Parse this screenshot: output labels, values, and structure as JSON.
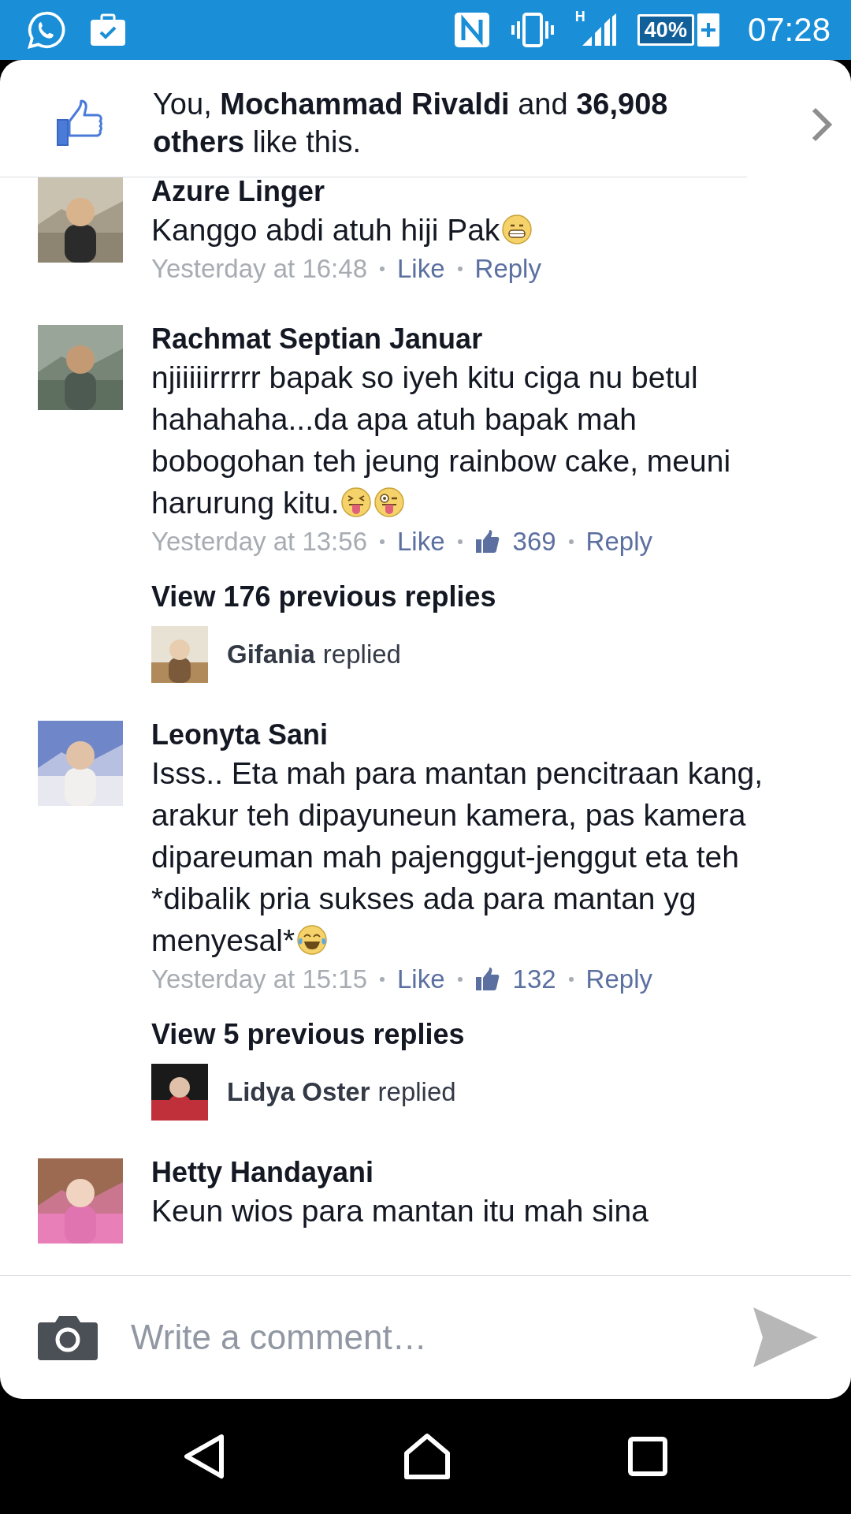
{
  "status_bar": {
    "network": "H",
    "battery": "40%",
    "time": "07:28"
  },
  "likes_summary": "You, **Mochammad Rivaldi** and **36,908 others** like this.",
  "comments": [
    {
      "author": "Azure Linger",
      "text": "Kanggo abdi atuh hiji Pak",
      "emojis": [
        {
          "kind": "grin"
        }
      ],
      "time": "Yesterday at 16:48",
      "like": "Like",
      "reply": "Reply"
    },
    {
      "author": "Rachmat Septian Januar",
      "text": "njiiiiirrrrr bapak so iyeh kitu ciga nu betul hahahaha...da apa atuh bapak mah bobogohan teh jeung rainbow cake, meuni harurung kitu.",
      "emojis": [
        {
          "kind": "tongue"
        },
        {
          "kind": "wink-tongue"
        }
      ],
      "time": "Yesterday at 13:56",
      "like": "Like",
      "like_count": "369",
      "reply": "Reply",
      "replies": {
        "label": "View 176 previous replies",
        "author": "Gifania",
        "action": "replied"
      }
    },
    {
      "author": "Leonyta Sani",
      "text": "Isss.. Eta mah para mantan pencitraan kang, arakur teh dipayuneun kamera, pas kamera dipareuman mah pajenggut-jenggut eta teh *dibalik pria sukses ada para mantan yg menyesal*",
      "emojis": [
        {
          "kind": "tears-of-joy"
        }
      ],
      "time": "Yesterday at 15:15",
      "like": "Like",
      "like_count": "132",
      "reply": "Reply",
      "replies": {
        "label": "View 5 previous replies",
        "author": "Lidya Oster",
        "action": "replied"
      }
    },
    {
      "author": "Hetty Handayani",
      "text": "Keun wios para mantan itu mah sina"
    }
  ],
  "composer": {
    "placeholder": "Write a comment…"
  }
}
